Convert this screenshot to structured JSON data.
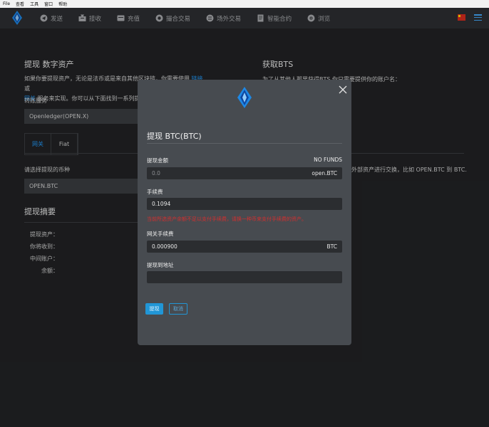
{
  "os_menu": [
    "File",
    "查看",
    "工具",
    "窗口",
    "帮助"
  ],
  "header": {
    "nav": [
      {
        "label": "发送",
        "icon": "send-icon"
      },
      {
        "label": "接收",
        "icon": "receive-icon"
      },
      {
        "label": "充值",
        "icon": "deposit-icon"
      },
      {
        "label": "撮合交易",
        "icon": "exchange-icon"
      },
      {
        "label": "场外交易",
        "icon": "otc-icon"
      },
      {
        "label": "智能合约",
        "icon": "contract-icon"
      },
      {
        "label": "浏览",
        "icon": "explore-icon"
      }
    ],
    "language_flag": "cn-flag-icon",
    "menu_icon": "hamburger-icon"
  },
  "background": {
    "left_title": "提现 数字资产",
    "left_para_1": "如果你要提现资产，无论是法币或是来自其他区块链，你需要使用",
    "left_para_link_1": "链接",
    "left_para_2": "或",
    "left_para_link_2": "网关",
    "left_para_3": "服务来实现。你可以从下面找到一系列提供",
    "service_label": "转账服务",
    "service_value": "Openledger(OPEN.X)",
    "tabs": [
      "网关",
      "Fiat"
    ],
    "coin_label": "请选择提现的币种",
    "coin_value": "OPEN.BTC",
    "summary_title": "提现摘要",
    "summary_rows": [
      "提现资产：",
      "你将收到：",
      "中间账户：",
      "余额："
    ],
    "right_title": "获取BTS",
    "right_para": "为了从其他人那里获得BTS,你只需要提供你的账户名：",
    "right_para_2": "外部资产进行交换，比如 OPEN.BTC 到 BTC."
  },
  "modal": {
    "title": "提现 BTC(BTC)",
    "amount_label": "提现金额",
    "funds_status": "NO FUNDS",
    "amount_placeholder": "0.0",
    "amount_unit": "open.BTC",
    "fee_label": "手续费",
    "fee_value": "0.1094",
    "error_text": "当前所选资产余额不足以支付手续费，请换一种币来支付手续费的资产。",
    "gateway_fee_label": "网关手续费",
    "gateway_fee_value": "0.000900",
    "gateway_fee_unit": "BTC",
    "address_label": "提现到地址",
    "address_value": "",
    "submit_label": "提现",
    "cancel_label": "取消"
  },
  "colors": {
    "accent": "#2196f3",
    "error": "#d32f2f",
    "modal_bg": "#474b50",
    "input_bg": "#2b2d30",
    "page_bg": "#212224",
    "header_bg": "#2c2e31"
  }
}
